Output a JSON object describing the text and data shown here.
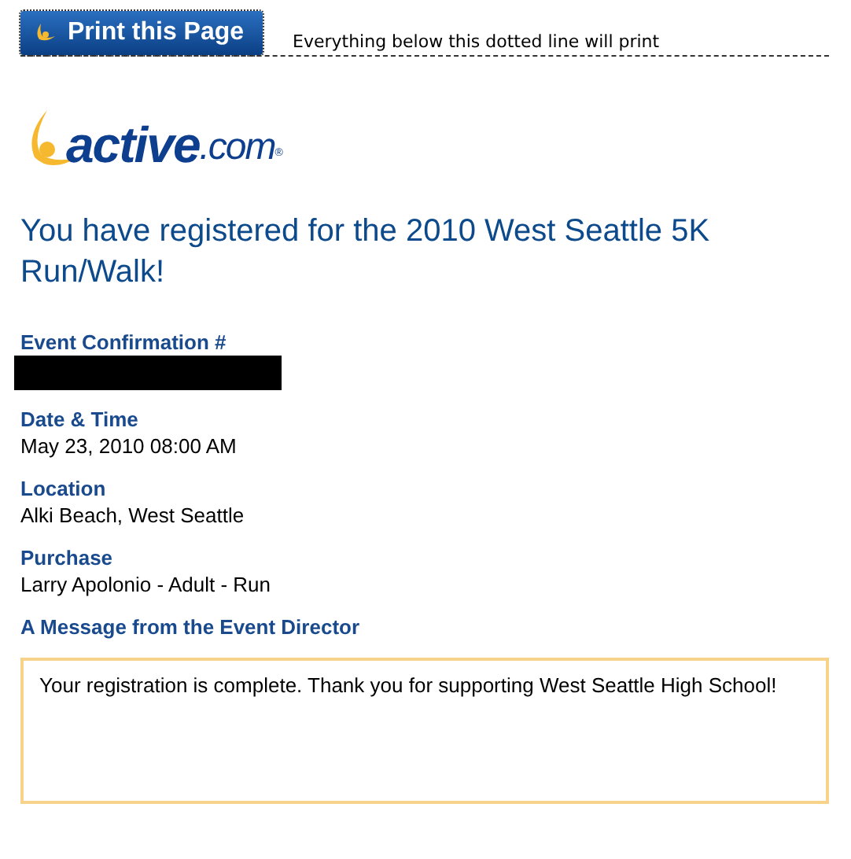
{
  "print_button": {
    "label": "Print this Page"
  },
  "print_note": "Everything below this dotted line will print",
  "logo": {
    "name": "active",
    "suffix": ".com",
    "mark": "®"
  },
  "heading": "You have registered for the 2010 West Seattle 5K Run/Walk!",
  "fields": [
    {
      "label": "Event Confirmation #",
      "redacted": true
    },
    {
      "label": "Date & Time",
      "value": "May 23, 2010 08:00 AM",
      "redacted": false
    },
    {
      "label": "Location",
      "value": "Alki Beach, West Seattle",
      "redacted": false
    },
    {
      "label": "Purchase",
      "value": "Larry Apolonio - Adult - Run",
      "redacted": false
    }
  ],
  "message": {
    "label": "A Message from the Event Director",
    "text": "Your registration is complete. Thank you for supporting West Seattle High School!"
  }
}
